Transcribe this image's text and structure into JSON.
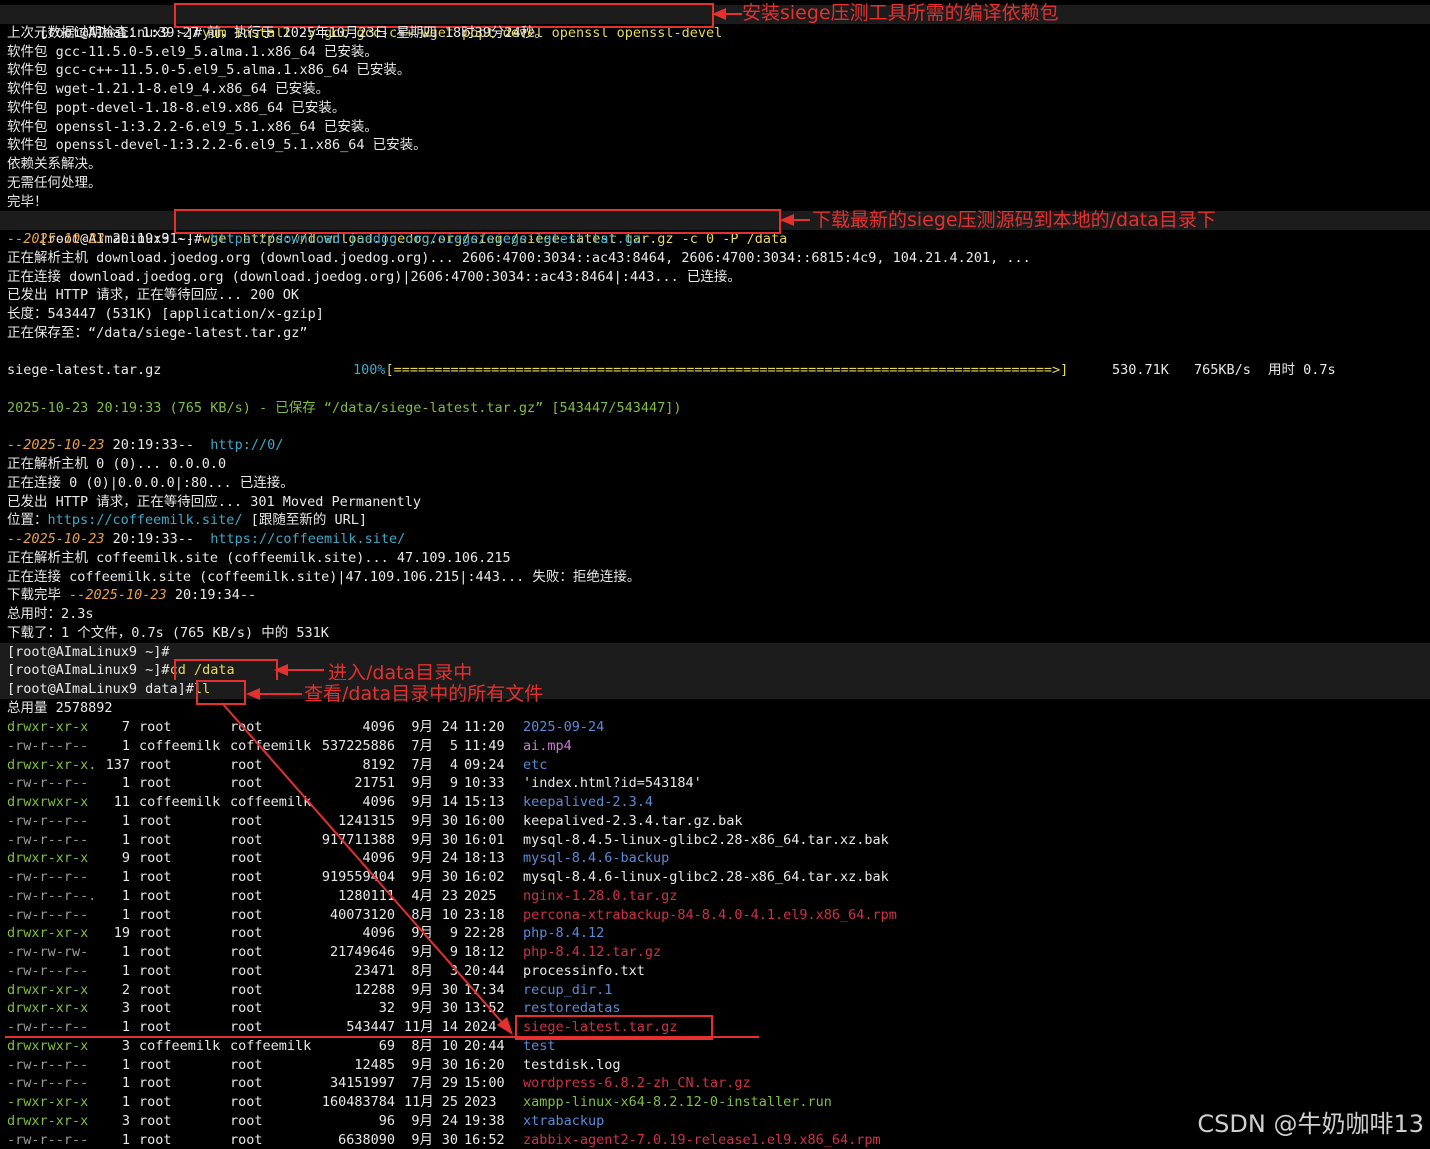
{
  "prompt_root": "[root@AImaLinux9 ~]#",
  "prompt_data": "[root@AImaLinux9 data]#",
  "cmd_yum": "yum install -y gcc gcc-c++ wget popt-devel openssl openssl-devel",
  "anno_yum": "安装siege压测工具所需的编译依赖包",
  "yum_out": [
    "上次元数据过期检查：1:39:27 前，执行于 2025年10月23日 星期四 18时39分24秒。",
    "软件包 gcc-11.5.0-5.el9_5.alma.1.x86_64 已安装。",
    "软件包 gcc-c++-11.5.0-5.el9_5.alma.1.x86_64 已安装。",
    "软件包 wget-1.21.1-8.el9_4.x86_64 已安装。",
    "软件包 popt-devel-1.18-8.el9.x86_64 已安装。",
    "软件包 openssl-1:3.2.2-6.el9_5.1.x86_64 已安装。",
    "软件包 openssl-devel-1:3.2.2-6.el9_5.1.x86_64 已安装。",
    "依赖关系解决。",
    "无需任何处理。",
    "完毕！"
  ],
  "cmd_wget": "wget https://download.joedog.org/siege/siege-latest.tar.gz -c 0 -P /data",
  "anno_wget": "下载最新的siege压测源码到本地的/data目录下",
  "wget_out": {
    "l1_date": "--2025-10-23 ",
    "l1_time": "20:19:31--  ",
    "l1_url": "https://download.joedog.org/siege/siege-latest.tar.gz",
    "l2": "正在解析主机 download.joedog.org (download.joedog.org)... 2606:4700:3034::ac43:8464, 2606:4700:3034::6815:4c9, 104.21.4.201, ...",
    "l3": "正在连接 download.joedog.org (download.joedog.org)|2606:4700:3034::ac43:8464|:443... 已连接。",
    "l4": "已发出 HTTP 请求，正在等待回应... 200 OK",
    "l5": "长度：543447 (531K) [application/x-gzip]",
    "l6": "正在保存至：“/data/siege-latest.tar.gz”",
    "prog_file": "siege-latest.tar.gz",
    "prog_pct": "100%",
    "prog_bar": "[=================================================================================>]",
    "prog_size": "530.71K",
    "prog_rate": "765KB/s",
    "prog_time": "用时 0.7s",
    "saved": "2025-10-23 20:19:33 (765 KB/s) - 已保存 “/data/siege-latest.tar.gz” [543447/543447])",
    "h1_date": "--2025-10-23 ",
    "h1_time": "20:19:33--  ",
    "h1_url": "http://0/",
    "h2": "正在解析主机 0 (0)... 0.0.0.0",
    "h3": "正在连接 0 (0)|0.0.0.0|:80... 已连接。",
    "h4": "已发出 HTTP 请求，正在等待回应... 301 Moved Permanently",
    "h5a": "位置：",
    "h5b": "https://coffeemilk.site/",
    "h5c": " [跟随至新的 URL]",
    "h6_date": "--2025-10-23 ",
    "h6_time": "20:19:33--  ",
    "h6_url": "https://coffeemilk.site/",
    "h7": "正在解析主机 coffeemilk.site (coffeemilk.site)... 47.109.106.215",
    "h8": "正在连接 coffeemilk.site (coffeemilk.site)|47.109.106.215|:443... 失败：拒绝连接。",
    "h9a": "下载完毕 ",
    "h9b": "--2025-10-23 ",
    "h9c": "20:19:34--",
    "h10": "总用时：2.3s",
    "h11": "下载了：1 个文件，0.7s (765 KB/s) 中的 531K"
  },
  "cmd_cd": "cd /data",
  "anno_cd": "进入/data目录中",
  "cmd_ll": "ll",
  "anno_ll": "查看/data目录中的所有文件",
  "total": "总用量 2578892",
  "files": [
    {
      "perm": "drwxr-xr-x",
      "n": "7",
      "u": "root",
      "g": "root",
      "size": "4096",
      "mon": "9月",
      "day": "24",
      "time": "11:20",
      "name": "2025-09-24",
      "cls": "b"
    },
    {
      "perm": "-rw-r--r--",
      "n": "1",
      "u": "coffeemilk",
      "g": "coffeemilk",
      "size": "537225886",
      "mon": "7月",
      "day": "5",
      "time": "11:49",
      "name": "ai.mp4",
      "cls": "m"
    },
    {
      "perm": "drwxr-xr-x.",
      "n": "137",
      "u": "root",
      "g": "root",
      "size": "8192",
      "mon": "7月",
      "day": "4",
      "time": "09:24",
      "name": "etc",
      "cls": "b"
    },
    {
      "perm": "-rw-r--r--",
      "n": "1",
      "u": "root",
      "g": "root",
      "size": "21751",
      "mon": "9月",
      "day": "9",
      "time": "10:33",
      "name": "'index.html?id=543184'",
      "cls": "w"
    },
    {
      "perm": "drwxrwxr-x",
      "n": "11",
      "u": "coffeemilk",
      "g": "coffeemilk",
      "size": "4096",
      "mon": "9月",
      "day": "14",
      "time": "15:13",
      "name": "keepalived-2.3.4",
      "cls": "b"
    },
    {
      "perm": "-rw-r--r--",
      "n": "1",
      "u": "root",
      "g": "root",
      "size": "1241315",
      "mon": "9月",
      "day": "30",
      "time": "16:00",
      "name": "keepalived-2.3.4.tar.gz.bak",
      "cls": "w"
    },
    {
      "perm": "-rw-r--r--",
      "n": "1",
      "u": "root",
      "g": "root",
      "size": "917711388",
      "mon": "9月",
      "day": "30",
      "time": "16:01",
      "name": "mysql-8.4.5-linux-glibc2.28-x86_64.tar.xz.bak",
      "cls": "w"
    },
    {
      "perm": "drwxr-xr-x",
      "n": "9",
      "u": "root",
      "g": "root",
      "size": "4096",
      "mon": "9月",
      "day": "24",
      "time": "18:13",
      "name": "mysql-8.4.6-backup",
      "cls": "b"
    },
    {
      "perm": "-rw-r--r--",
      "n": "1",
      "u": "root",
      "g": "root",
      "size": "919559404",
      "mon": "9月",
      "day": "30",
      "time": "16:02",
      "name": "mysql-8.4.6-linux-glibc2.28-x86_64.tar.xz.bak",
      "cls": "w"
    },
    {
      "perm": "-rw-r--r--.",
      "n": "1",
      "u": "root",
      "g": "root",
      "size": "1280111",
      "mon": "4月",
      "day": "23",
      "time": "2025",
      "name": "nginx-1.28.0.tar.gz",
      "cls": "z"
    },
    {
      "perm": "-rw-r--r--",
      "n": "1",
      "u": "root",
      "g": "root",
      "size": "40073120",
      "mon": "8月",
      "day": "10",
      "time": "23:18",
      "name": "percona-xtrabackup-84-8.4.0-4.1.el9.x86_64.rpm",
      "cls": "z"
    },
    {
      "perm": "drwxr-xr-x",
      "n": "19",
      "u": "root",
      "g": "root",
      "size": "4096",
      "mon": "9月",
      "day": "9",
      "time": "22:28",
      "name": "php-8.4.12",
      "cls": "b"
    },
    {
      "perm": "-rw-rw-rw-",
      "n": "1",
      "u": "root",
      "g": "root",
      "size": "21749646",
      "mon": "9月",
      "day": "9",
      "time": "18:12",
      "name": "php-8.4.12.tar.gz",
      "cls": "z"
    },
    {
      "perm": "-rw-r--r--",
      "n": "1",
      "u": "root",
      "g": "root",
      "size": "23471",
      "mon": "8月",
      "day": "3",
      "time": "20:44",
      "name": "processinfo.txt",
      "cls": "w"
    },
    {
      "perm": "drwxr-xr-x",
      "n": "2",
      "u": "root",
      "g": "root",
      "size": "12288",
      "mon": "9月",
      "day": "30",
      "time": "17:34",
      "name": "recup_dir.1",
      "cls": "b"
    },
    {
      "perm": "drwxr-xr-x",
      "n": "3",
      "u": "root",
      "g": "root",
      "size": "32",
      "mon": "9月",
      "day": "30",
      "time": "13:52",
      "name": "restoredatas",
      "cls": "b"
    },
    {
      "perm": "-rw-r--r--",
      "n": "1",
      "u": "root",
      "g": "root",
      "size": "543447",
      "mon": "11月",
      "day": "14",
      "time": "2024",
      "name": "siege-latest.tar.gz",
      "cls": "z"
    },
    {
      "perm": "drwxrwxr-x",
      "n": "3",
      "u": "coffeemilk",
      "g": "coffeemilk",
      "size": "69",
      "mon": "8月",
      "day": "10",
      "time": "20:44",
      "name": "test",
      "cls": "b"
    },
    {
      "perm": "-rw-r--r--",
      "n": "1",
      "u": "root",
      "g": "root",
      "size": "12485",
      "mon": "9月",
      "day": "30",
      "time": "16:20",
      "name": "testdisk.log",
      "cls": "w"
    },
    {
      "perm": "-rw-r--r--",
      "n": "1",
      "u": "root",
      "g": "root",
      "size": "34151997",
      "mon": "7月",
      "day": "29",
      "time": "15:00",
      "name": "wordpress-6.8.2-zh_CN.tar.gz",
      "cls": "z"
    },
    {
      "perm": "-rwxr-xr-x",
      "n": "1",
      "u": "root",
      "g": "root",
      "size": "160483784",
      "mon": "11月",
      "day": "25",
      "time": "2023",
      "name": "xampp-linux-x64-8.2.12-0-installer.run",
      "cls": "g"
    },
    {
      "perm": "drwxr-xr-x",
      "n": "3",
      "u": "root",
      "g": "root",
      "size": "96",
      "mon": "9月",
      "day": "24",
      "time": "19:38",
      "name": "xtrabackup",
      "cls": "b"
    },
    {
      "perm": "-rw-r--r--",
      "n": "1",
      "u": "root",
      "g": "root",
      "size": "6638090",
      "mon": "9月",
      "day": "30",
      "time": "16:52",
      "name": "zabbix-agent2-7.0.19-release1.el9.x86_64.rpm",
      "cls": "z"
    }
  ],
  "watermark": "CSDN @牛奶咖啡13",
  "colors": {
    "annotation": "#e53030",
    "background": "#000000"
  }
}
